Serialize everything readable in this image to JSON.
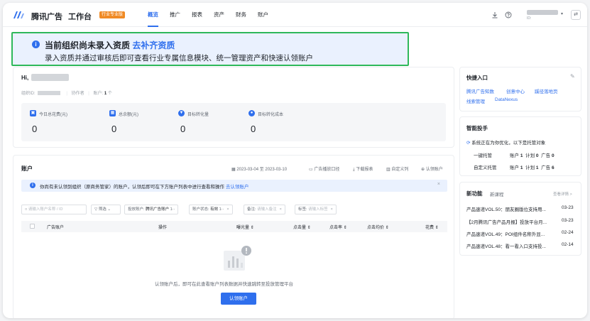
{
  "header": {
    "brand": "腾讯广告",
    "workbench": "工作台",
    "edition_badge": "行业专业版",
    "nav": [
      "概览",
      "推广",
      "报表",
      "资产",
      "财务",
      "账户"
    ],
    "active_nav": "概览",
    "account_id_label": "ID:",
    "icons": [
      "download-icon",
      "help-icon",
      "chevron-down-icon",
      "swap-icon"
    ]
  },
  "notice": {
    "title": "当前组织尚未录入资质",
    "link": "去补齐资质",
    "desc": "录入资质并通过审核后即可查看行业专属信息模块、统一管理资产和快速认领账户"
  },
  "overview": {
    "greeting": "Hi,",
    "org_id_label": "组织ID:",
    "role": "协作者",
    "account_label": "账户:",
    "account_count": "1",
    "account_unit": "个",
    "stats": [
      {
        "label": "今日总花费(元)",
        "value": "0",
        "icon": "wallet-icon"
      },
      {
        "label": "总余额(元)",
        "value": "0",
        "icon": "balance-icon"
      },
      {
        "label": "目标转化量",
        "value": "0",
        "icon": "target-icon"
      },
      {
        "label": "目标转化成本",
        "value": "0",
        "icon": "cost-icon"
      }
    ]
  },
  "accounts": {
    "title": "账户",
    "date_range": "2023-03-04 至 2023-03-10",
    "tools": [
      "广告播放口径",
      "下载报表",
      "自定义列",
      "认领账户"
    ],
    "info": "你尚有未认领到组织（原商务管家）的账户，认领后即可在下方账户列表中进行查看和操作",
    "info_link": "去认领账户",
    "search_placeholder": "请输入账户名称 / ID",
    "filter_label": "筛选",
    "filters": [
      {
        "label": "投放账户:",
        "value": "腾讯广告账户",
        "suffix": "1··"
      },
      {
        "label": "账户状态:",
        "value": "有效",
        "suffix": "1··"
      },
      {
        "label": "备注:",
        "value": "",
        "placeholder": "请输入备注"
      },
      {
        "label": "标签:",
        "value": "",
        "placeholder": "请输入标签"
      }
    ],
    "columns": [
      "广告账户",
      "操作",
      "曝光量",
      "点击量",
      "点击率",
      "点击均价",
      "花费"
    ],
    "empty_text": "认领账户后，即可在此查看账户列表数据并快速跳转至投放管理平台",
    "claim_button": "认领账户"
  },
  "quick": {
    "title": "快捷入口",
    "links": [
      "腾讯广告知数",
      "创意中心",
      "蹊径落地页",
      "线索管理",
      "DataNexus"
    ]
  },
  "assistant": {
    "title": "智能投手",
    "status": "系统正在为你优化，以下是托管对象",
    "rows": [
      {
        "label": "一键托管",
        "account_label": "账户",
        "account": "1",
        "plan_label": "计划",
        "plan": "0",
        "ad_label": "广告",
        "ad": "0"
      },
      {
        "label": "自定义托管",
        "account_label": "账户",
        "account": "1",
        "plan_label": "计划",
        "plan": "1",
        "ad_label": "广告",
        "ad": "6"
      }
    ]
  },
  "news": {
    "title": "新功能",
    "tab2": "新课程",
    "more": "查看详情 >",
    "items": [
      {
        "text": "产品速递VOL.50：朋友圈版位支持用...",
        "date": "03-23"
      },
      {
        "text": "【2月腾讯广告产品月报】投放平台月...",
        "date": "03-23"
      },
      {
        "text": "产品速递VOL.49：POI组件名称外显...",
        "date": "02-24"
      },
      {
        "text": "产品速递VOL.48：看一看入口支持投...",
        "date": "02-14"
      }
    ]
  }
}
